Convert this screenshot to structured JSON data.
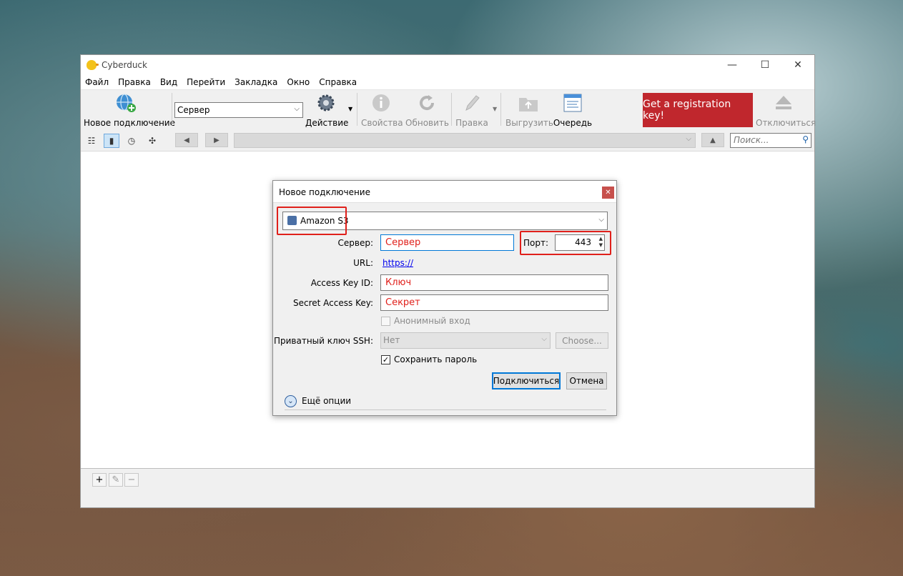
{
  "app": {
    "title": "Cyberduck"
  },
  "window_controls": {
    "minimize": "—",
    "maximize": "☐",
    "close": "✕"
  },
  "menu": [
    "Файл",
    "Правка",
    "Вид",
    "Перейти",
    "Закладка",
    "Окно",
    "Справка"
  ],
  "toolbar": {
    "new_connection": "Новое подключение",
    "protocol_select": "Сервер",
    "action": "Действие",
    "info": "Свойства",
    "refresh": "Обновить",
    "edit": "Правка",
    "upload": "Выгрузить",
    "queue": "Очередь",
    "registration": "Get a registration key!",
    "disconnect": "Отключиться"
  },
  "navbar": {
    "search_placeholder": "Поиск..."
  },
  "dialog": {
    "title": "Новое подключение",
    "protocol": "Amazon S3",
    "server_label": "Сервер:",
    "server_value": "Сервер",
    "port_label": "Порт:",
    "port_value": "443",
    "url_label": "URL:",
    "url_value": "https://",
    "access_key_label": "Access Key ID:",
    "access_key_value": "Ключ",
    "secret_key_label": "Secret Access Key:",
    "secret_key_value": "Секрет",
    "anonymous_label": "Анонимный вход",
    "ssh_key_label": "Приватный ключ SSH:",
    "ssh_key_value": "Нет",
    "choose_label": "Choose...",
    "save_password_label": "Сохранить пароль",
    "save_password_checked": true,
    "connect_label": "Подключиться",
    "cancel_label": "Отмена",
    "more_options_label": "Ещё опции"
  },
  "colors": {
    "highlight": "#e0201b",
    "registration_bg": "#c0272d",
    "accent": "#0078d7"
  }
}
